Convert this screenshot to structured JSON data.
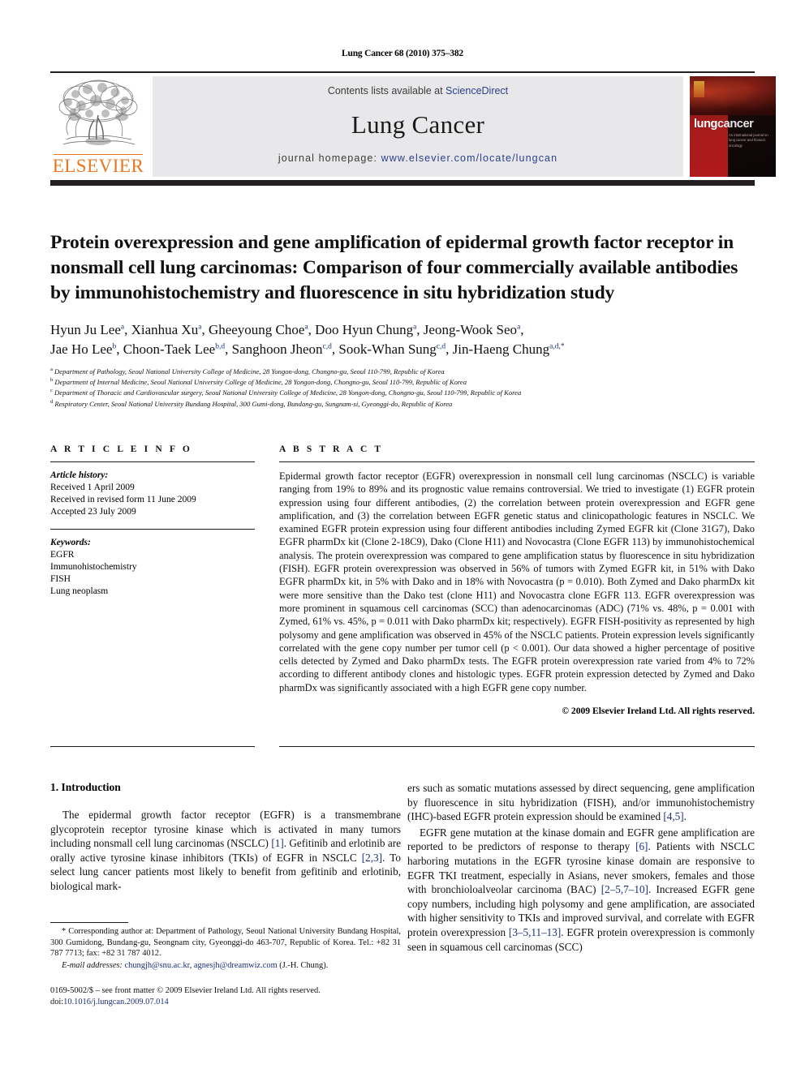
{
  "running_head": "Lung Cancer 68 (2010) 375–382",
  "masthead": {
    "contents_prefix": "Contents lists available at ",
    "sciencedirect": "ScienceDirect",
    "journal_title": "Lung Cancer",
    "homepage_prefix": "journal homepage: ",
    "homepage_url": "www.elsevier.com/locate/lungcan",
    "publisher_logo_text": "ELSEVIER",
    "cover": {
      "title_part1": "lung",
      "title_part2": "cancer",
      "subtitle": "An international journal on lung cancer and thoracic oncology"
    }
  },
  "article": {
    "title": "Protein overexpression and gene amplification of epidermal growth factor receptor in nonsmall cell lung carcinomas: Comparison of four commercially available antibodies by immunohistochemistry and fluorescence in situ hybridization study",
    "authors_line1": "Hyun Ju Lee a, Xianhua Xu a, Gheeyoung Choe a, Doo Hyun Chung a, Jeong-Wook Seo a,",
    "authors_line2": "Jae Ho Lee b, Choon-Taek Lee b,d, Sanghoon Jheon c,d, Sook-Whan Sung c,d, Jin-Haeng Chung a,d,*",
    "affiliations": [
      {
        "mark": "a",
        "text": "Department of Pathology, Seoul National University College of Medicine, 28 Yongon-dong, Chongno-gu, Seoul 110-799, Republic of Korea"
      },
      {
        "mark": "b",
        "text": "Department of Internal Medicine, Seoul National University College of Medicine, 28 Yongon-dong, Chongno-gu, Seoul 110-799, Republic of Korea"
      },
      {
        "mark": "c",
        "text": "Department of Thoracic and Cardiovascular surgery, Seoul National University College of Medicine, 28 Yongon-dong, Chongno-gu, Seoul 110-799, Republic of Korea"
      },
      {
        "mark": "d",
        "text": "Respiratory Center, Seoul National University Bundang Hospital, 300 Gumi-dong, Bundang-gu, Sungnam-si, Gyeonggi-do, Republic of Korea"
      }
    ]
  },
  "article_info": {
    "heading": "A R T I C L E   I N F O",
    "history_label": "Article history:",
    "history": [
      "Received 1 April 2009",
      "Received in revised form 11 June 2009",
      "Accepted 23 July 2009"
    ],
    "keywords_label": "Keywords:",
    "keywords": [
      "EGFR",
      "Immunohistochemistry",
      "FISH",
      "Lung neoplasm"
    ]
  },
  "abstract": {
    "heading": "A B S T R A C T",
    "body": "Epidermal growth factor receptor (EGFR) overexpression in nonsmall cell lung carcinomas (NSCLC) is variable ranging from 19% to 89% and its prognostic value remains controversial. We tried to investigate (1) EGFR protein expression using four different antibodies, (2) the correlation between protein overexpression and EGFR gene amplification, and (3) the correlation between EGFR genetic status and clinicopathologic features in NSCLC. We examined EGFR protein expression using four different antibodies including Zymed EGFR kit (Clone 31G7), Dako EGFR pharmDx kit (Clone 2-18C9), Dako (Clone H11) and Novocastra (Clone EGFR 113) by immunohistochemical analysis. The protein overexpression was compared to gene amplification status by fluorescence in situ hybridization (FISH). EGFR protein overexpression was observed in 56% of tumors with Zymed EGFR kit, in 51% with Dako EGFR pharmDx kit, in 5% with Dako and in 18% with Novocastra (p = 0.010). Both Zymed and Dako pharmDx kit were more sensitive than the Dako test (clone H11) and Novocastra clone EGFR 113. EGFR overexpression was more prominent in squamous cell carcinomas (SCC) than adenocarcinomas (ADC) (71% vs. 48%, p = 0.001 with Zymed, 61% vs. 45%, p = 0.011 with Dako pharmDx kit; respectively). EGFR FISH-positivity as represented by high polysomy and gene amplification was observed in 45% of the NSCLC patients. Protein expression levels significantly correlated with the gene copy number per tumor cell (p < 0.001). Our data showed a higher percentage of positive cells detected by Zymed and Dako pharmDx tests. The EGFR protein overexpression rate varied from 4% to 72% according to different antibody clones and histologic types. EGFR protein expression detected by Zymed and Dako pharmDx was significantly associated with a high EGFR gene copy number.",
    "copyright": "© 2009 Elsevier Ireland Ltd. All rights reserved."
  },
  "introduction": {
    "heading": "1.  Introduction",
    "left_paragraph_1_a": "The epidermal growth factor receptor (EGFR) is a transmembrane glycoprotein receptor tyrosine kinase which is activated in many tumors including nonsmall cell lung carcinomas (NSCLC) ",
    "left_ref_1": "[1]",
    "left_paragraph_1_b": ". Gefitinib and erlotinib are orally active tyrosine kinase inhibitors (TKIs) of EGFR in NSCLC ",
    "left_ref_2": "[2,3]",
    "left_paragraph_1_c": ". To select lung cancer patients most likely to benefit from gefitinib and erlotinib, biological mark-",
    "right_paragraph_1_a": "ers such as somatic mutations assessed by direct sequencing, gene amplification by fluorescence in situ hybridization (FISH), and/or immunohistochemistry (IHC)-based EGFR protein expression should be examined ",
    "right_ref_1": "[4,5]",
    "right_paragraph_1_b": ".",
    "right_paragraph_2_a": "EGFR gene mutation at the kinase domain and EGFR gene amplification are reported to be predictors of response to therapy ",
    "right_ref_2": "[6]",
    "right_paragraph_2_b": ". Patients with NSCLC harboring mutations in the EGFR tyrosine kinase domain are responsive to EGFR TKI treatment, especially in Asians, never smokers, females and those with bronchioloalveolar carcinoma (BAC) ",
    "right_ref_3": "[2–5,7–10]",
    "right_paragraph_2_c": ". Increased EGFR gene copy numbers, including high polysomy and gene amplification, are associated with higher sensitivity to TKIs and improved survival, and correlate with EGFR protein overexpression ",
    "right_ref_4": "[3–5,11–13]",
    "right_paragraph_2_d": ". EGFR protein overexpression is commonly seen in squamous cell carcinomas (SCC)"
  },
  "footnote": {
    "corresponding": "* Corresponding author at: Department of Pathology, Seoul National University Bundang Hospital, 300 Gumidong, Bundang-gu, Seongnam city, Gyeonggi-do 463-707, Republic of Korea. Tel.: +82 31 787 7713; fax: +82 31 787 4012.",
    "email_label": "E-mail addresses:",
    "email1": "chungjh@snu.ac.kr",
    "email2": "agnesjh@dreamwiz.com",
    "email_suffix": "(J.-H. Chung).",
    "issn_line": "0169-5002/$ – see front matter © 2009 Elsevier Ireland Ltd. All rights reserved.",
    "doi_label": "doi:",
    "doi_value": "10.1016/j.lungcan.2009.07.014"
  },
  "colors": {
    "elsevier_orange": "#e87722",
    "link_blue": "#2b3f8c",
    "ref_blue": "#1b2f7a",
    "masthead_grey": "#e8e8ea",
    "dark_bar": "#231f20"
  }
}
